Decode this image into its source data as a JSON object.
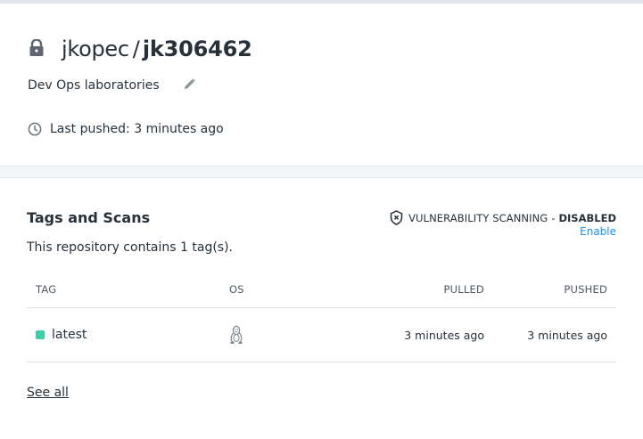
{
  "repo": {
    "owner": "jkopec",
    "separator": "/",
    "name": "jk306462",
    "description": "Dev Ops laboratories",
    "last_pushed": "Last pushed: 3 minutes ago"
  },
  "tags_section": {
    "heading": "Tags and Scans",
    "count_text": "This repository contains 1 tag(s).",
    "vulnerability": {
      "label": "VULNERABILITY SCANNING",
      "separator": "-",
      "status": "DISABLED",
      "enable_link": "Enable"
    },
    "columns": {
      "tag": "TAG",
      "os": "OS",
      "pulled": "PULLED",
      "pushed": "PUSHED"
    },
    "rows": [
      {
        "tag": "latest",
        "os_icon": "linux-icon",
        "pulled": "3 minutes ago",
        "pushed": "3 minutes ago"
      }
    ],
    "see_all": "See all"
  },
  "colors": {
    "text": "#27313b",
    "link": "#1c90ed",
    "tag_dot": "#3ecfa9",
    "band": "#f4f5f7"
  },
  "icons": [
    "lock-icon",
    "edit-icon",
    "clock-icon",
    "shield-icon",
    "linux-icon"
  ]
}
